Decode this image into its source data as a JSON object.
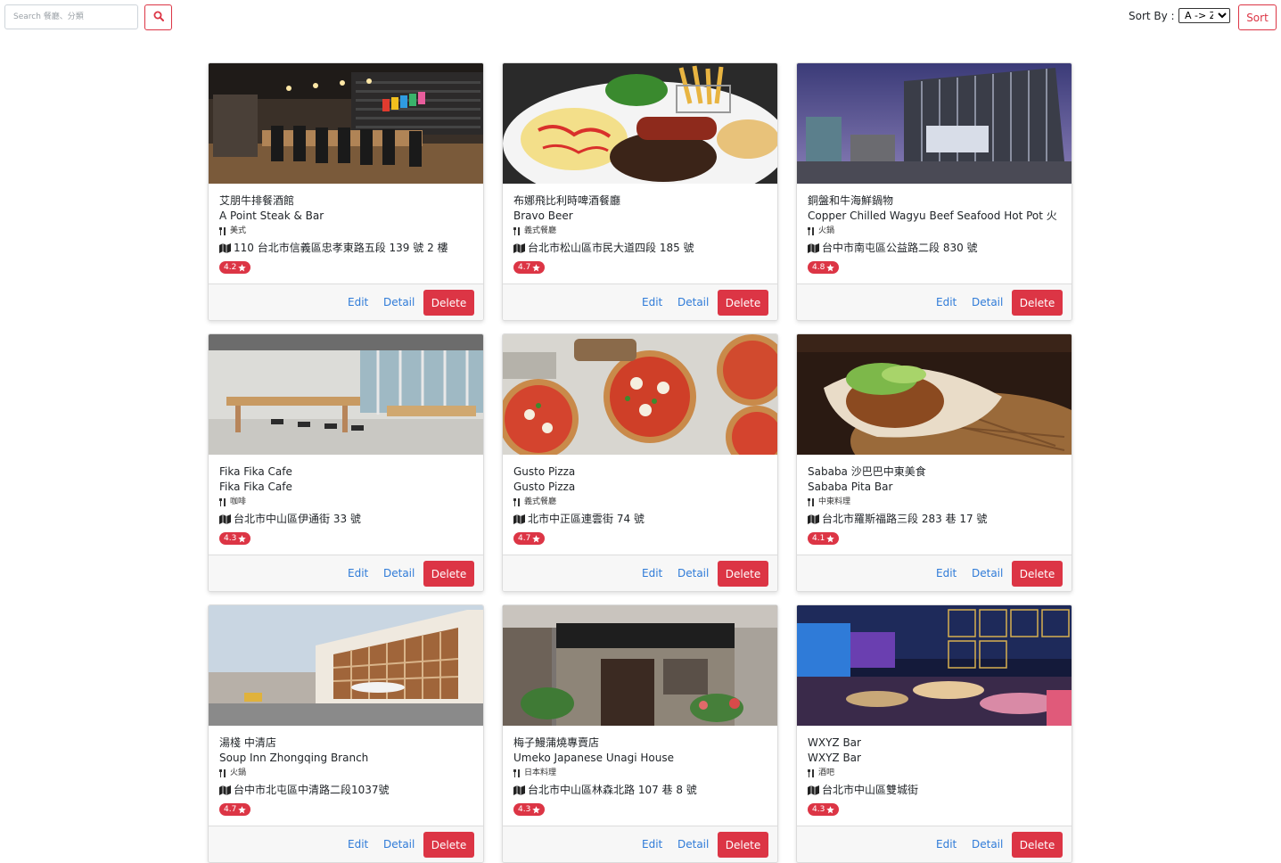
{
  "search": {
    "placeholder": "Search 餐廳、分類",
    "icon": "search-icon"
  },
  "sort": {
    "label": "Sort By :",
    "selected": "A -> Z",
    "button_label": "Sort"
  },
  "colors": {
    "accent": "#dc3545",
    "link": "#2f7bd8"
  },
  "restaurants": [
    {
      "name_zh": "艾朋牛排餐酒館",
      "name_en": "A Point Steak & Bar",
      "category": "美式",
      "address": "110 台北市信義區忠孝東路五段 139 號 2 樓",
      "rating": "4.2",
      "edit": "Edit",
      "detail": "Detail",
      "delete": "Delete"
    },
    {
      "name_zh": "布娜飛比利時啤酒餐廳",
      "name_en": "Bravo Beer",
      "category": "義式餐廳",
      "address": "台北市松山區市民大道四段 185 號",
      "rating": "4.7",
      "edit": "Edit",
      "detail": "Detail",
      "delete": "Delete"
    },
    {
      "name_zh": "銅盤和牛海鮮鍋物",
      "name_en": "Copper Chilled Wagyu Beef Seafood Hot Pot 火",
      "category": "火鍋",
      "address": "台中市南屯區公益路二段 830 號",
      "rating": "4.8",
      "edit": "Edit",
      "detail": "Detail",
      "delete": "Delete"
    },
    {
      "name_zh": "Fika Fika Cafe",
      "name_en": "Fika Fika Cafe",
      "category": "咖啡",
      "address": "台北市中山區伊通街 33 號",
      "rating": "4.3",
      "edit": "Edit",
      "detail": "Detail",
      "delete": "Delete"
    },
    {
      "name_zh": "Gusto Pizza",
      "name_en": "Gusto Pizza",
      "category": "義式餐廳",
      "address": "北市中正區連雲街 74 號",
      "rating": "4.7",
      "edit": "Edit",
      "detail": "Detail",
      "delete": "Delete"
    },
    {
      "name_zh": "Sababa 沙巴巴中東美食",
      "name_en": "Sababa Pita Bar",
      "category": "中東料理",
      "address": "台北市羅斯福路三段 283 巷 17 號",
      "rating": "4.1",
      "edit": "Edit",
      "detail": "Detail",
      "delete": "Delete"
    },
    {
      "name_zh": "湯棧 中清店",
      "name_en": "Soup Inn Zhongqing Branch",
      "category": "火鍋",
      "address": "台中市北屯區中清路二段1037號",
      "rating": "4.7",
      "edit": "Edit",
      "detail": "Detail",
      "delete": "Delete"
    },
    {
      "name_zh": "梅子鰻蒲燒專賣店",
      "name_en": "Umeko Japanese Unagi House",
      "category": "日本料理",
      "address": "台北市中山區林森北路 107 巷 8 號",
      "rating": "4.3",
      "edit": "Edit",
      "detail": "Detail",
      "delete": "Delete"
    },
    {
      "name_zh": "WXYZ Bar",
      "name_en": "WXYZ Bar",
      "category": "酒吧",
      "address": "台北市中山區雙城街",
      "rating": "4.3",
      "edit": "Edit",
      "detail": "Detail",
      "delete": "Delete"
    }
  ]
}
